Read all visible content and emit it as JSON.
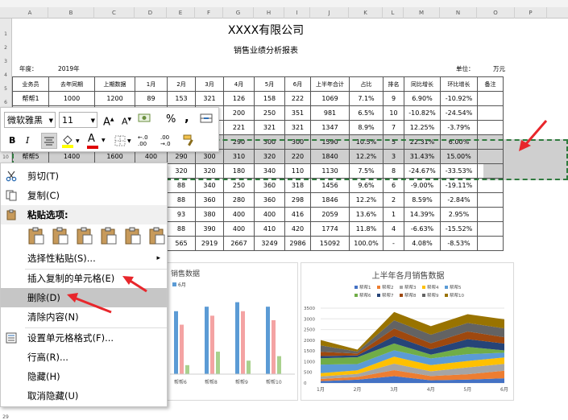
{
  "columns": [
    "A",
    "B",
    "C",
    "D",
    "E",
    "F",
    "G",
    "H",
    "I",
    "J",
    "K",
    "L",
    "M",
    "N",
    "O",
    "P"
  ],
  "rows": [
    "1",
    "2",
    "3",
    "4",
    "5",
    "6",
    "7",
    "8",
    "9",
    "10",
    "11",
    "12",
    "13",
    "14",
    "15",
    "16",
    "17",
    "18",
    "19",
    "20",
    "21",
    "22",
    "23",
    "24",
    "25",
    "26",
    "27",
    "28",
    "29"
  ],
  "sheet": {
    "title": "XXXX有限公司",
    "subtitle": "销售业绩分析报表",
    "year_label": "年度：",
    "year_value": "2019年",
    "unit_label": "单位：",
    "unit_value": "万元",
    "headers": [
      "业务员",
      "去年同期",
      "上期数据",
      "1月",
      "2月",
      "3月",
      "4月",
      "5月",
      "6月",
      "上半年合计",
      "占比",
      "排名",
      "同比增长",
      "环比增长",
      "备注"
    ],
    "table_rows": [
      [
        "帮帮1",
        "1000",
        "1200",
        "89",
        "153",
        "321",
        "126",
        "158",
        "222",
        "1069",
        "7.1%",
        "9",
        "6.90%",
        "-10.92%",
        ""
      ],
      [
        "",
        "",
        "",
        "",
        "",
        "",
        "200",
        "250",
        "351",
        "981",
        "6.5%",
        "10",
        "-10.82%",
        "-24.54%",
        ""
      ],
      [
        "",
        "",
        "",
        "",
        "",
        "",
        "221",
        "321",
        "321",
        "1347",
        "8.9%",
        "7",
        "12.25%",
        "-3.79%",
        ""
      ],
      [
        "",
        "",
        "",
        "",
        "",
        "",
        "290",
        "300",
        "300",
        "1590",
        "10.5%",
        "5",
        "22.31%",
        "6.00%",
        ""
      ],
      [
        "帮帮5",
        "1400",
        "1600",
        "400",
        "290",
        "300",
        "310",
        "320",
        "220",
        "1840",
        "12.2%",
        "3",
        "31.43%",
        "15.00%",
        ""
      ],
      [
        "",
        "",
        "",
        "",
        "320",
        "320",
        "180",
        "340",
        "110",
        "1130",
        "7.5%",
        "8",
        "-24.67%",
        "-33.53%",
        ""
      ],
      [
        "",
        "",
        "",
        "",
        "88",
        "340",
        "250",
        "360",
        "318",
        "1456",
        "9.6%",
        "6",
        "-9.00%",
        "-19.11%",
        ""
      ],
      [
        "",
        "",
        "",
        "",
        "88",
        "360",
        "280",
        "360",
        "298",
        "1846",
        "12.2%",
        "2",
        "8.59%",
        "-2.84%",
        ""
      ],
      [
        "",
        "",
        "",
        "",
        "93",
        "380",
        "400",
        "400",
        "416",
        "2059",
        "13.6%",
        "1",
        "14.39%",
        "2.95%",
        ""
      ],
      [
        "",
        "",
        "",
        "",
        "88",
        "390",
        "400",
        "410",
        "420",
        "1774",
        "11.8%",
        "4",
        "-6.63%",
        "-15.52%",
        ""
      ],
      [
        "",
        "",
        "",
        "",
        "565",
        "2919",
        "2667",
        "3249",
        "2986",
        "15092",
        "100.0%",
        "-",
        "4.08%",
        "-8.53%",
        ""
      ]
    ]
  },
  "toolbar": {
    "font_name": "微软雅黑",
    "font_size": "11",
    "grow_font": "A",
    "shrink_font": "A",
    "percent": "%",
    "comma": ",",
    "bold": "B",
    "italic": "I",
    "font_color_letter": "A",
    "dec_inc": "←.0 .00",
    "dec_dec": ".00 →.0"
  },
  "menu": {
    "cut": "剪切(T)",
    "copy": "复制(C)",
    "paste_options": "粘贴选项:",
    "paste_special": "选择性粘贴(S)...",
    "insert_copied": "插入复制的单元格(E)",
    "delete": "删除(D)",
    "clear": "清除内容(N)",
    "format_cells": "设置单元格格式(F)...",
    "row_height": "行高(R)...",
    "hide": "隐藏(H)",
    "unhide": "取消隐藏(U)"
  },
  "chart_data": [
    {
      "type": "bar",
      "title": "销售数据",
      "legend": [
        "6月"
      ],
      "categories": [
        "帮帮6",
        "帮帮8",
        "帮帮9",
        "帮帮10"
      ],
      "series": [
        {
          "values": [
            1400,
            1500,
            1600,
            1500
          ]
        },
        {
          "values": [
            1100,
            1300,
            1400,
            1200
          ]
        },
        {
          "values": [
            200,
            500,
            300,
            400
          ]
        }
      ]
    },
    {
      "type": "area",
      "title": "上半年各月销售数据",
      "categories": [
        "1月",
        "2月",
        "3月",
        "4月",
        "5月",
        "6月"
      ],
      "legend_row1": [
        "帮帮1",
        "帮帮2",
        "帮帮3",
        "帮帮4",
        "帮帮5"
      ],
      "legend_row2": [
        "帮帮6",
        "帮帮7",
        "帮帮8",
        "帮帮9",
        "帮帮10"
      ],
      "ylim": [
        0,
        3500
      ],
      "yticks": [
        "3500",
        "3000",
        "2500",
        "2000",
        "1500",
        "1000",
        "500",
        "0"
      ],
      "series_colors": [
        "#4472c4",
        "#ed7d31",
        "#a5a5a5",
        "#ffc000",
        "#5b9bd5",
        "#70ad47",
        "#264478",
        "#9e480e",
        "#636363",
        "#997300"
      ],
      "series": [
        {
          "name": "帮帮1",
          "values": [
            89,
            153,
            321,
            126,
            158,
            222
          ]
        },
        {
          "name": "帮帮2",
          "values": [
            100,
            130,
            280,
            200,
            250,
            351
          ]
        },
        {
          "name": "帮帮3",
          "values": [
            120,
            140,
            300,
            221,
            321,
            321
          ]
        },
        {
          "name": "帮帮4",
          "values": [
            150,
            170,
            330,
            290,
            300,
            300
          ]
        },
        {
          "name": "帮帮5",
          "values": [
            400,
            290,
            300,
            310,
            320,
            220
          ]
        },
        {
          "name": "帮帮6",
          "values": [
            300,
            320,
            320,
            180,
            340,
            110
          ]
        },
        {
          "name": "帮帮7",
          "values": [
            100,
            88,
            340,
            250,
            360,
            318
          ]
        },
        {
          "name": "帮帮8",
          "values": [
            200,
            88,
            360,
            280,
            360,
            298
          ]
        },
        {
          "name": "帮帮9",
          "values": [
            300,
            93,
            380,
            400,
            400,
            416
          ]
        },
        {
          "name": "帮帮10",
          "values": [
            250,
            88,
            390,
            400,
            410,
            420
          ]
        }
      ]
    }
  ]
}
